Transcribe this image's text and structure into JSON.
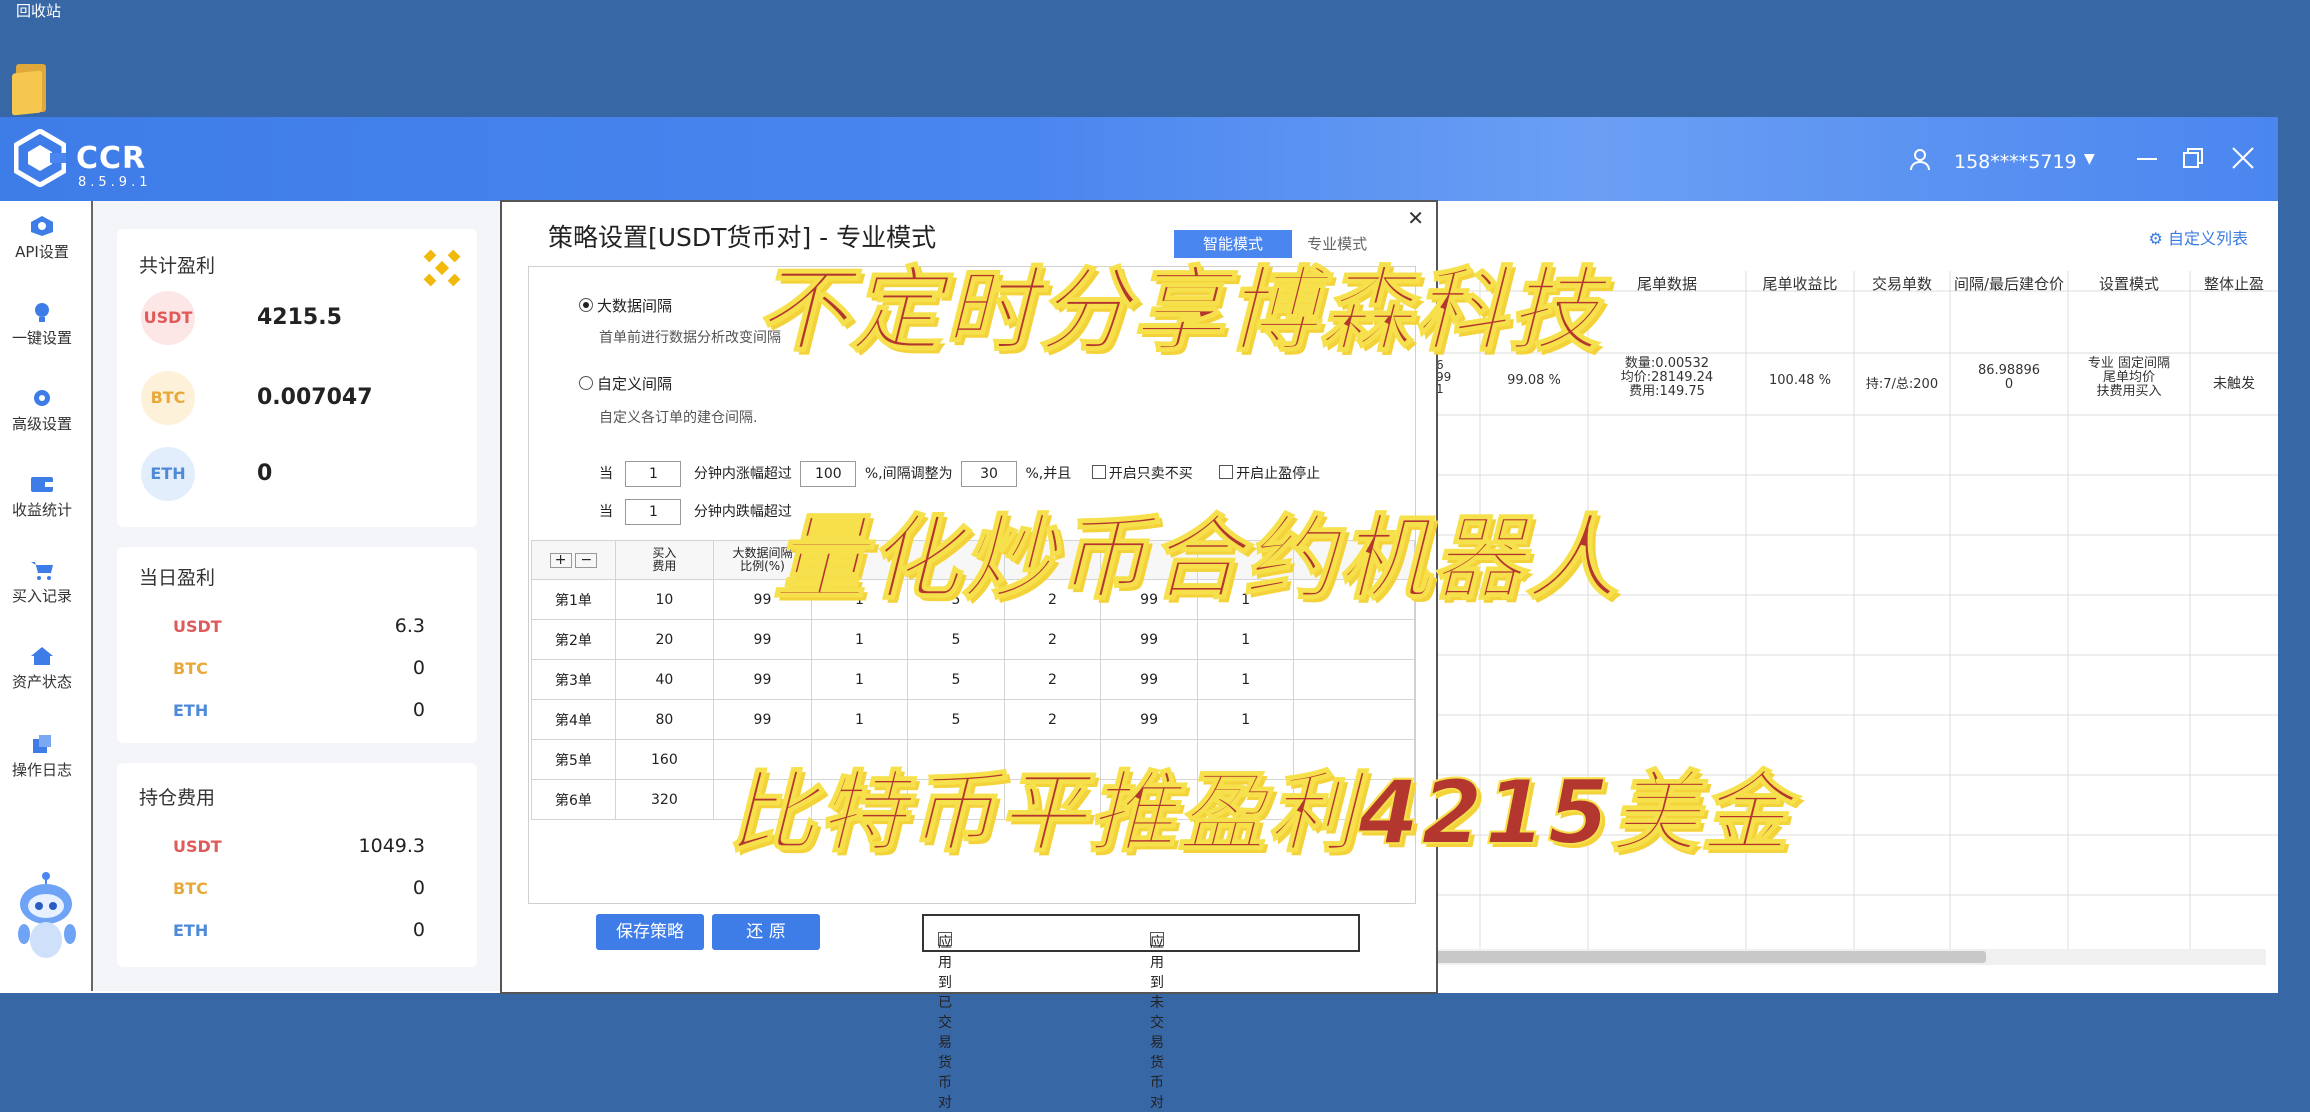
{
  "desktop": {
    "recycle_bin_label": "回收站"
  },
  "app": {
    "brand": "CCR",
    "version": "8.5.9.1",
    "user_phone": "158****5719"
  },
  "sidebar": {
    "items": [
      {
        "label": "API设置",
        "icon": "api-icon"
      },
      {
        "label": "一键设置",
        "icon": "bulb-icon"
      },
      {
        "label": "高级设置",
        "icon": "gear-icon"
      },
      {
        "label": "收益统计",
        "icon": "wallet-icon"
      },
      {
        "label": "买入记录",
        "icon": "cart-icon"
      },
      {
        "label": "资产状态",
        "icon": "home-icon"
      },
      {
        "label": "操作日志",
        "icon": "log-icon"
      }
    ]
  },
  "stats": {
    "total": {
      "title": "共计盈利",
      "usdt_label": "USDT",
      "usdt": "4215.5",
      "btc_label": "BTC",
      "btc": "0.007047",
      "eth_label": "ETH",
      "eth": "0"
    },
    "daily": {
      "title": "当日盈利",
      "usdt_label": "USDT",
      "usdt": "6.3",
      "btc_label": "BTC",
      "btc": "0",
      "eth_label": "ETH",
      "eth": "0"
    },
    "holding": {
      "title": "持仓费用",
      "usdt_label": "USDT",
      "usdt": "1049.3",
      "btc_label": "BTC",
      "btc": "0",
      "eth_label": "ETH",
      "eth": "0"
    }
  },
  "main_table": {
    "custom_list_label": "自定义列表",
    "headers": [
      "尾单数据",
      "尾单收益比",
      "交易单数",
      "间隔/最后建仓价",
      "设置模式",
      "整体止盈"
    ],
    "row": {
      "partial_a": "6\n99\n1",
      "percent": "99.08 %",
      "tail_data": "数量:0.00532\n均价:28149.24\n费用:149.75",
      "tail_ratio": "100.48 %",
      "trade_count": "持:7/总:200",
      "interval": "86.98896\n0",
      "mode": "专业 固定间隔\n尾单均价\n扶费用买入",
      "stop": "未触发"
    }
  },
  "dialog": {
    "title": "策略设置[USDT货币对] - 专业模式",
    "mode_smart": "智能模式",
    "mode_pro": "专业模式",
    "radio_bigdata": "大数据间隔",
    "radio_bigdata_hint": "首单前进行数据分析改变间隔",
    "radio_custom": "自定义间隔",
    "radio_custom_hint": "自定义各订单的建仓间隔.",
    "cond1": {
      "when": "当",
      "minutes": "1",
      "rise_text": "分钟内涨幅超过",
      "rise_val": "100",
      "adjust_text": "%,间隔调整为",
      "adjust_val": "30",
      "and_text": "%,并且",
      "opt1": "开启只卖不买",
      "opt2": "开启止盈停止"
    },
    "cond2": {
      "when": "当",
      "minutes": "1",
      "fall_text": "分钟内跌幅超过"
    },
    "table": {
      "add": "+",
      "remove": "−",
      "headers": [
        "买入\n费用",
        "大数据间隔\n比例(%)",
        "",
        "",
        "",
        "",
        ""
      ],
      "rows": [
        {
          "name": "第1单",
          "cost": "10",
          "c1": "99",
          "c2": "1",
          "c3": "5",
          "c4": "2",
          "c5": "99",
          "c6": "1"
        },
        {
          "name": "第2单",
          "cost": "20",
          "c1": "99",
          "c2": "1",
          "c3": "5",
          "c4": "2",
          "c5": "99",
          "c6": "1"
        },
        {
          "name": "第3单",
          "cost": "40",
          "c1": "99",
          "c2": "1",
          "c3": "5",
          "c4": "2",
          "c5": "99",
          "c6": "1"
        },
        {
          "name": "第4单",
          "cost": "80",
          "c1": "99",
          "c2": "1",
          "c3": "5",
          "c4": "2",
          "c5": "99",
          "c6": "1"
        },
        {
          "name": "第5单",
          "cost": "160",
          "c1": "",
          "c2": "",
          "c3": "",
          "c4": "",
          "c5": "",
          "c6": ""
        },
        {
          "name": "第6单",
          "cost": "320",
          "c1": "",
          "c2": "",
          "c3": "",
          "c4": "",
          "c5": "",
          "c6": ""
        }
      ]
    },
    "save_label": "保存策略",
    "reset_label": "还 原",
    "apply_existing": "应用到已交易货币对",
    "apply_new": "应用到未交易货币对"
  },
  "overlay": {
    "line1": "不定时分享博森科技",
    "line2": "量化炒币合约机器人",
    "line3": "比特币平推盈利4215美金"
  },
  "colors": {
    "accent": "#3e7ce8",
    "usdt": "#e05a5a",
    "btc": "#e8a93a",
    "eth": "#4f8ad8",
    "overlay_text": "#b3372f",
    "overlay_stroke": "#f6e04b"
  }
}
